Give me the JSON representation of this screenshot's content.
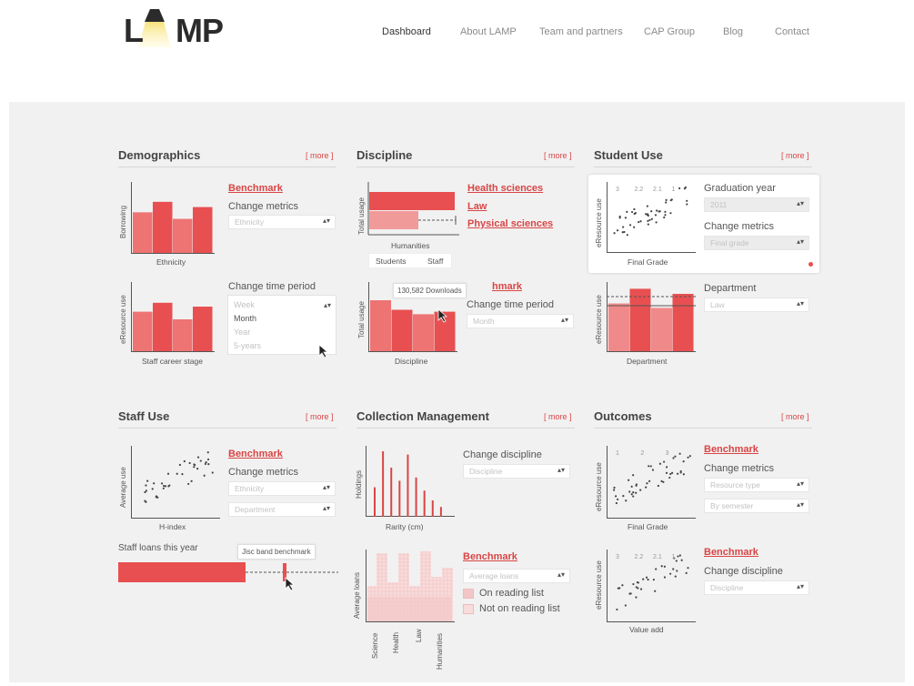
{
  "brand": {
    "logo_left": "L",
    "logo_right": "MP"
  },
  "nav": [
    "Dashboard",
    "About LAMP",
    "Team and partners",
    "CAP Group",
    "Blog",
    "Contact"
  ],
  "more": "[ more ]",
  "colors": {
    "accent": "#d94545",
    "bar": "#e84f50",
    "bar_light": "#f19a9a"
  },
  "demographics": {
    "title": "Demographics",
    "c1": {
      "ylabel": "Borrowing",
      "xlabel": "Ethnicity",
      "values": [
        0.62,
        0.78,
        0.52,
        0.7
      ]
    },
    "benchmark": "Benchmark",
    "change_metrics": "Change metrics",
    "metric_value": "Ethnicity",
    "c2": {
      "ylabel": "eResource use",
      "xlabel": "Staff career stage",
      "values": [
        0.62,
        0.76,
        0.5,
        0.7
      ]
    },
    "change_time": "Change time period",
    "time_options": [
      "Week",
      "Month",
      "Year",
      "5-years"
    ]
  },
  "discipline": {
    "title": "Discipline",
    "c1": {
      "ylabel": "Total usage",
      "xlabel": "Humanities",
      "toggle": [
        "Students",
        "Staff"
      ],
      "links": [
        "Health sciences",
        "Law",
        "Physical sciences"
      ]
    },
    "c2": {
      "ylabel": "Total usage",
      "xlabel": "Discipline",
      "values": [
        0.8,
        0.65,
        0.58,
        0.62
      ],
      "tooltip": "130,582 Downloads",
      "link_partial": "hmark"
    },
    "change_time": "Change time period",
    "time_value": "Month"
  },
  "student_use": {
    "title": "Student Use",
    "c1": {
      "ylabel": "eResource use",
      "xlabel": "Final Grade",
      "bands": [
        "3",
        "2.2",
        "2.1",
        "1"
      ]
    },
    "grad_year": "Graduation year",
    "grad_value": "2011",
    "change_metrics": "Change metrics",
    "metric_value": "Final grade",
    "c2": {
      "ylabel": "eResource use",
      "xlabel": "Department",
      "values": [
        0.75,
        0.98,
        0.68,
        0.9
      ]
    },
    "department": "Department",
    "dept_value": "Law"
  },
  "staff_use": {
    "title": "Staff Use",
    "c1": {
      "ylabel": "Average use",
      "xlabel": "H-index"
    },
    "benchmark": "Benchmark",
    "change_metrics": "Change metrics",
    "metric_values": [
      "Ethnicity",
      "Department"
    ],
    "loans_label": "Staff loans this year",
    "band_tip": "Jisc band benchmark"
  },
  "collection": {
    "title": "Collection Management",
    "c1": {
      "ylabel": "Holdings",
      "xlabel": "Rarity (cm)",
      "values": [
        0.45,
        1.0,
        0.75,
        0.55,
        0.95,
        0.6,
        0.4,
        0.25,
        0.15
      ]
    },
    "change_discipline": "Change discipline",
    "discipline_value": "Discipline",
    "c2": {
      "ylabel": "Average loans",
      "categories": [
        "Science",
        "Health",
        "Law",
        "Humanities"
      ]
    },
    "benchmark": "Benchmark",
    "avg_loans": "Average loans",
    "legend": [
      "On reading list",
      "Not on reading list"
    ]
  },
  "outcomes": {
    "title": "Outcomes",
    "c1": {
      "ylabel": "eResource use",
      "xlabel": "Final Grade",
      "bands": [
        "1",
        "2",
        "3"
      ]
    },
    "benchmark": "Benchmark",
    "change_metrics": "Change metrics",
    "metric_values": [
      "Resource type",
      "By semester"
    ],
    "c2": {
      "ylabel": "eResource use",
      "xlabel": "Value add",
      "bands": [
        "3",
        "2.2",
        "2.1",
        "1"
      ]
    },
    "benchmark2": "Benchmark",
    "change_discipline": "Change discipline",
    "discipline_value": "Discipline"
  }
}
